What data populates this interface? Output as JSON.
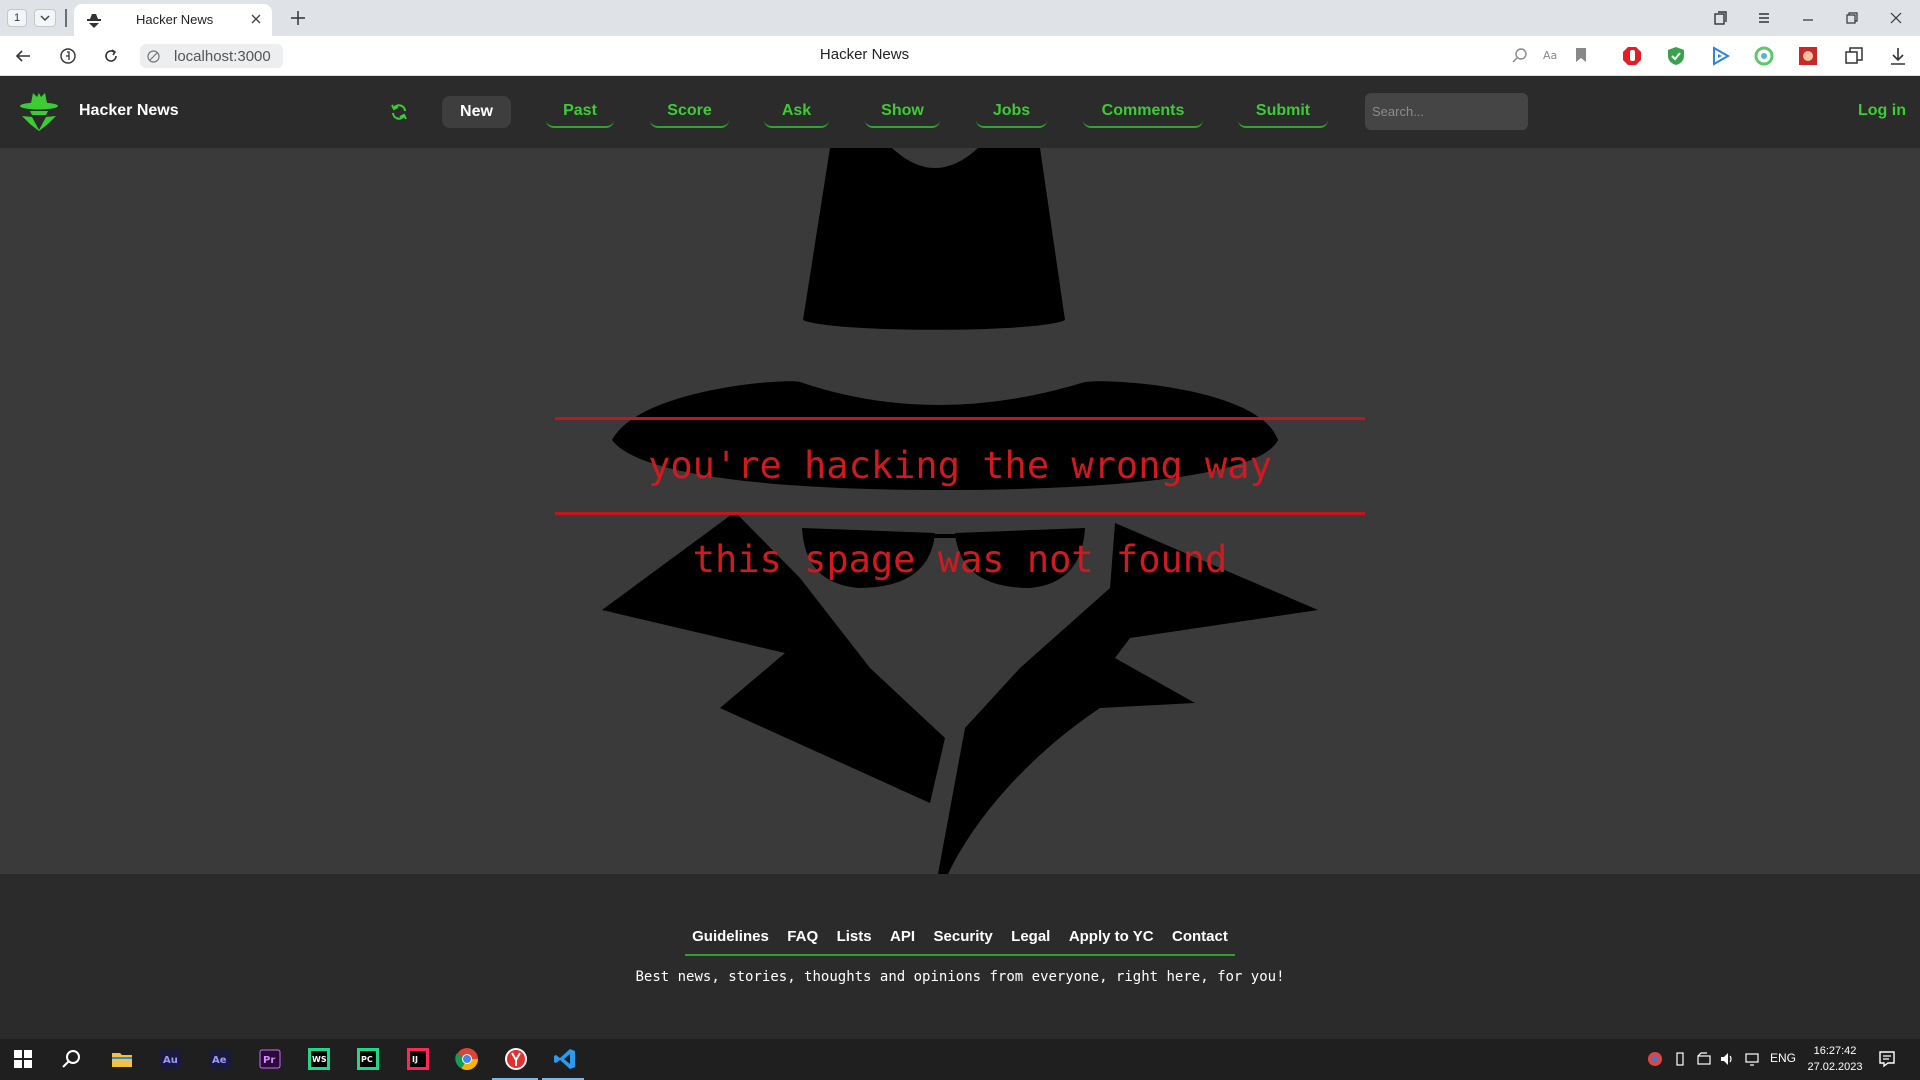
{
  "browser": {
    "tab_count": "1",
    "tab_title": "Hacker News",
    "address": "localhost:3000",
    "page_title": "Hacker News"
  },
  "header": {
    "brand": "Hacker News",
    "nav": [
      {
        "label": "New",
        "active": true
      },
      {
        "label": "Past"
      },
      {
        "label": "Score"
      },
      {
        "label": "Ask"
      },
      {
        "label": "Show"
      },
      {
        "label": "Jobs"
      },
      {
        "label": "Comments"
      },
      {
        "label": "Submit"
      }
    ],
    "search_placeholder": "Search...",
    "login": "Log in"
  },
  "error": {
    "line1": "you're hacking the wrong way",
    "line2": "this spage was not found"
  },
  "footer": {
    "links": [
      "Guidelines",
      "FAQ",
      "Lists",
      "API",
      "Security",
      "Legal",
      "Apply to YC",
      "Contact"
    ],
    "tagline": "Best news, stories, thoughts and opinions from everyone, right here, for you!"
  },
  "taskbar": {
    "apps": [
      "windows-start",
      "search",
      "file-explorer",
      "audition",
      "after-effects",
      "premiere-pro",
      "webstorm",
      "pycharm",
      "intellij-idea",
      "chrome",
      "yandex-browser",
      "vscode"
    ],
    "language": "ENG",
    "time": "16:27:42",
    "date": "27.02.2023"
  },
  "colors": {
    "accent_green": "#3ccd34",
    "error_red": "#d01a1f",
    "header_bg": "#2b2b2b",
    "main_bg": "#3a3a3a"
  }
}
